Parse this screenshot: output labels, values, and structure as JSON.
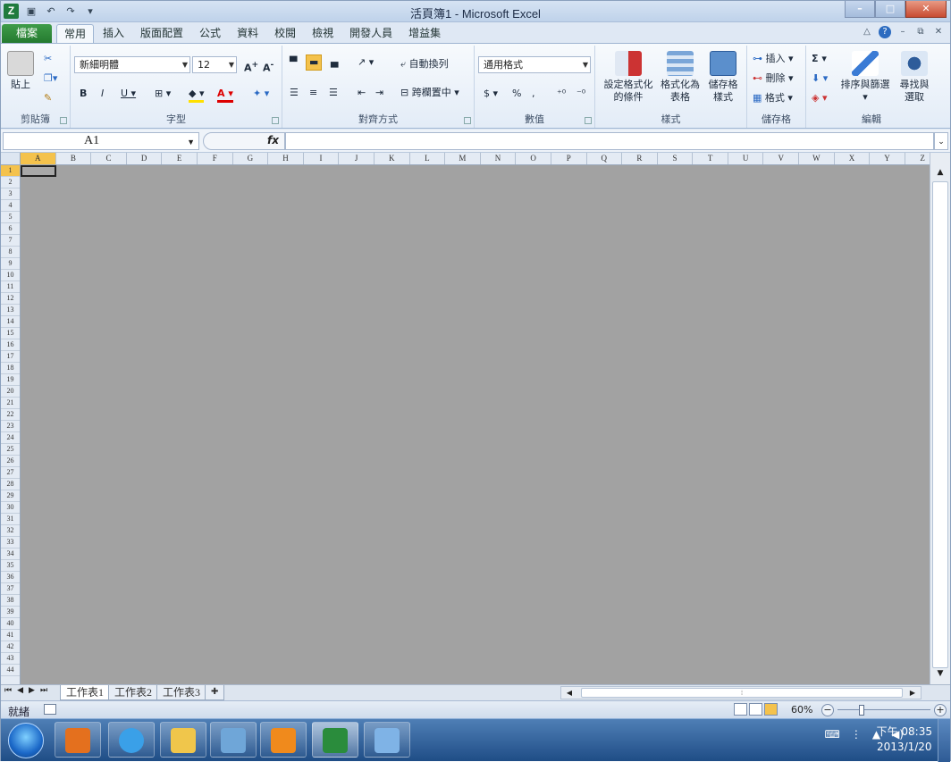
{
  "window": {
    "title": "活頁簿1 - Microsoft Excel",
    "app_icon": "Z"
  },
  "ribbon": {
    "file_tab": "檔案",
    "tabs": [
      "常用",
      "插入",
      "版面配置",
      "公式",
      "資料",
      "校閱",
      "檢視",
      "開發人員",
      "增益集"
    ],
    "clipboard": {
      "label": "剪貼簿",
      "paste": "貼上"
    },
    "font": {
      "label": "字型",
      "name": "新細明體",
      "size": "12"
    },
    "alignment": {
      "label": "對齊方式",
      "wrap": "自動換列",
      "merge": "跨欄置中"
    },
    "number": {
      "label": "數值",
      "format": "通用格式"
    },
    "styles": {
      "label": "樣式",
      "cond": [
        "設定格式化",
        "的條件"
      ],
      "table": [
        "格式化為",
        "表格"
      ],
      "cell": [
        "儲存格",
        "樣式"
      ]
    },
    "cells": {
      "label": "儲存格",
      "insert": "插入",
      "delete": "刪除",
      "format": "格式"
    },
    "editing": {
      "label": "編輯",
      "sort": "排序與篩選",
      "find": [
        "尋找與",
        "選取"
      ]
    }
  },
  "formula_bar": {
    "name_box": "A1",
    "fx": "fx",
    "formula": ""
  },
  "grid": {
    "columns": [
      "A",
      "B",
      "C",
      "D",
      "E",
      "F",
      "G",
      "H",
      "I",
      "J",
      "K",
      "L",
      "M",
      "N",
      "O",
      "P",
      "Q",
      "R",
      "S",
      "T",
      "U",
      "V",
      "W",
      "X",
      "Y",
      "Z"
    ],
    "rows": [
      "1",
      "2",
      "3",
      "4",
      "5",
      "6",
      "7",
      "8",
      "9",
      "10",
      "11",
      "12",
      "13",
      "14",
      "15",
      "16",
      "17",
      "18",
      "19",
      "20",
      "21",
      "22",
      "23",
      "24",
      "25",
      "26",
      "27",
      "28",
      "29",
      "30",
      "31",
      "32",
      "33",
      "34",
      "35",
      "36",
      "37",
      "38",
      "39",
      "40",
      "41",
      "42",
      "43",
      "44"
    ],
    "active_cell": "A1"
  },
  "sheet_tabs": [
    "工作表1",
    "工作表2",
    "工作表3"
  ],
  "status": {
    "mode": "就緒",
    "zoom": "60%"
  },
  "taskbar": {
    "time": "下午 08:35",
    "date": "2013/1/20"
  },
  "colors": {
    "accent": "#f4c24c",
    "file_tab": "#247a2f",
    "grid_bg": "#a2a2a2",
    "taskbar": "#1f4d86"
  }
}
